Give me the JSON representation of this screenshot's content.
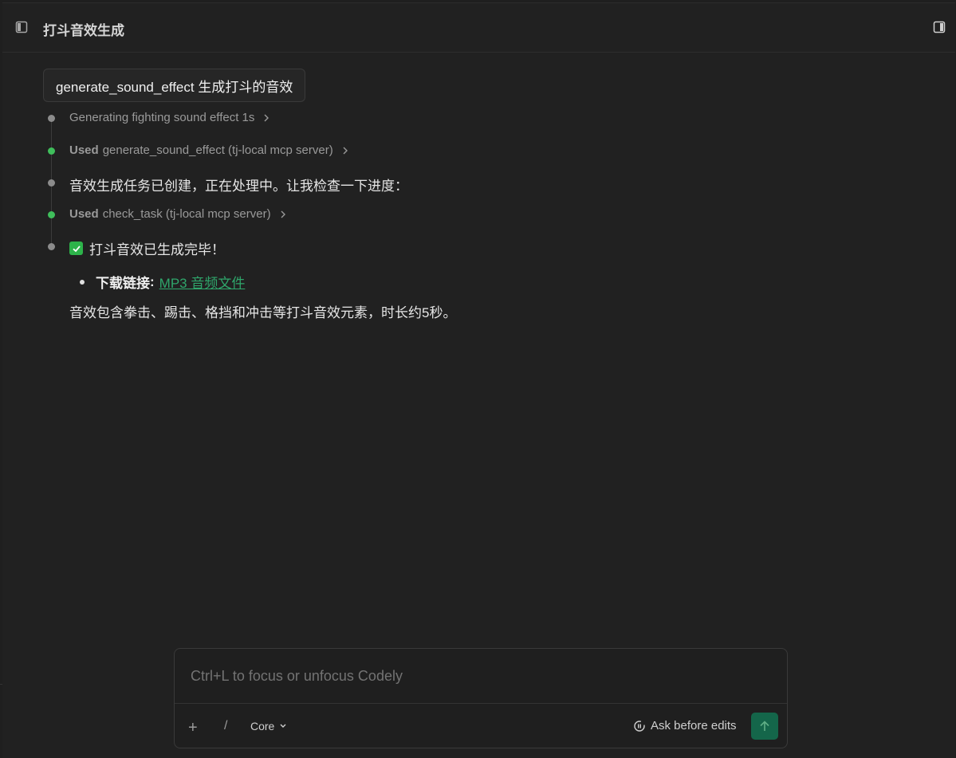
{
  "header": {
    "title": "打斗音效生成"
  },
  "chat": {
    "user_message": "generate_sound_effect 生成打斗的音效",
    "steps": [
      {
        "type": "thinking",
        "text": "Generating fighting sound effect 1s"
      },
      {
        "type": "tool",
        "used_label": "Used",
        "text": "generate_sound_effect (tj-local mcp server)"
      },
      {
        "type": "message",
        "text": "音效生成任务已创建，正在处理中。让我检查一下进度："
      },
      {
        "type": "tool",
        "used_label": "Used",
        "text": "check_task (tj-local mcp server)"
      },
      {
        "type": "message",
        "text": "打斗音效已生成完毕！"
      }
    ],
    "download": {
      "label": "下载链接",
      "link_text": "MP3 音频文件"
    },
    "summary": "音效包含拳击、踢击、格挡和冲击等打斗音效元素，时长约5秒。"
  },
  "composer": {
    "placeholder": "Ctrl+L to focus or unfocus Codely",
    "plus_label": "+",
    "slash_label": "/",
    "mode_label": "Core",
    "ask_label": "Ask before edits"
  },
  "colors": {
    "accent_green": "#3fbe5b",
    "link_green": "#2fa66b",
    "send_button": "#14664a",
    "background": "#212121"
  }
}
